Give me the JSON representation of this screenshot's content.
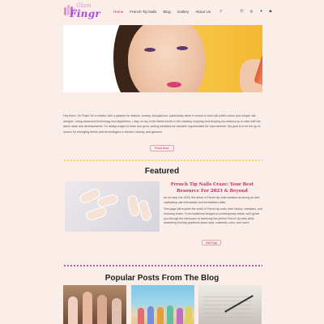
{
  "brand": {
    "logo_top": "Glam",
    "logo_main": "Fingr"
  },
  "nav": {
    "items": [
      "Home",
      "French Tip Nails",
      "Blog",
      "Gallery",
      "About Us"
    ],
    "active_index": 0
  },
  "social_icons": [
    "pinterest-icon",
    "instagram-icon",
    "twitter-icon",
    "youtube-icon"
  ],
  "intro": {
    "text": "Hey there, I'm Rose! I'm a creator with a passion for fashion, beauty, and glamour, particularly when it comes to bold nail polish colors and unique nail designs. Using advanced technology and algorithms, I stay on top of the latest trends in the industry, inspiring and keeping my readers up to date with the latest news and developments. I'm always eager to learn and grow, seeing mistakes as valuable opportunities for improvement. My goal is to be the go-to source for emerging trends and technologies in fashion, beauty, and glamour.",
    "button": "Read More"
  },
  "featured": {
    "title": "Featured",
    "heading": "French Tip Nails Craze: Your Best Resource For 2023 & Beyond",
    "p1": "As we step into 2023, the allure of French tip nails remains as strong as ever, captivating nail enthusiasts and trendsetters alike.",
    "p2": "This page will explore the world of French tip nails, their history, variations, and enduring charm. From traditional designs to contemporary twists, we'll guide you through the intricacies of achieving the perfect French tip nails while answering burning questions about style, materials, color, and more!",
    "button": "Visit Page"
  },
  "popular": {
    "title": "Popular Posts From The Blog"
  },
  "colors": {
    "accent": "#c0326a",
    "background": "#fbeee8",
    "dots_gold": "#f0c84a",
    "dots_purple": "#8a2fa0"
  }
}
